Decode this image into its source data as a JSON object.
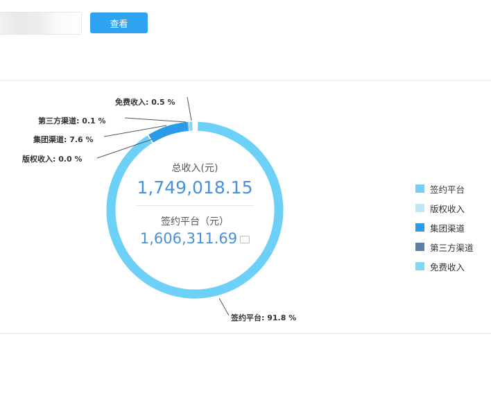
{
  "toolbar": {
    "search_input_value": "",
    "view_label": "查看"
  },
  "center": {
    "total_label": "总收入(元)",
    "total_value": "1,749,018.15",
    "selected_label": "签约平台（元）",
    "selected_value": "1,606,311.69"
  },
  "chart_data": {
    "type": "pie",
    "donut": true,
    "title": "",
    "slices": [
      {
        "name": "签约平台",
        "value": 91.8,
        "label": "签约平台: 91.8 %",
        "color": "#6dd1f7"
      },
      {
        "name": "版权收入",
        "value": 0.0,
        "label": "版权收入: 0.0 %",
        "color": "#bfe7fa"
      },
      {
        "name": "集团渠道",
        "value": 7.6,
        "label": "集团渠道: 7.6 %",
        "color": "#2b9ae8"
      },
      {
        "name": "第三方渠道",
        "value": 0.1,
        "label": "第三方渠道: 0.1 %",
        "color": "#5b7fa6"
      },
      {
        "name": "免费收入",
        "value": 0.5,
        "label": "免费收入: 0.5 %",
        "color": "#7fd6f7"
      }
    ],
    "legend_placement": "right"
  }
}
